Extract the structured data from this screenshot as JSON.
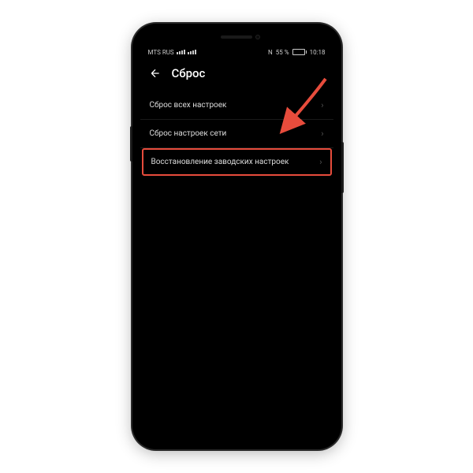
{
  "status_bar": {
    "carrier": "MTS RUS",
    "nfc_label": "N",
    "battery_percent": "55 %",
    "time": "10:18"
  },
  "header": {
    "title": "Сброс"
  },
  "list": {
    "items": [
      {
        "label": "Сброс всех настроек"
      },
      {
        "label": "Сброс настроек сети"
      },
      {
        "label": "Восстановление заводских настроек"
      }
    ]
  }
}
